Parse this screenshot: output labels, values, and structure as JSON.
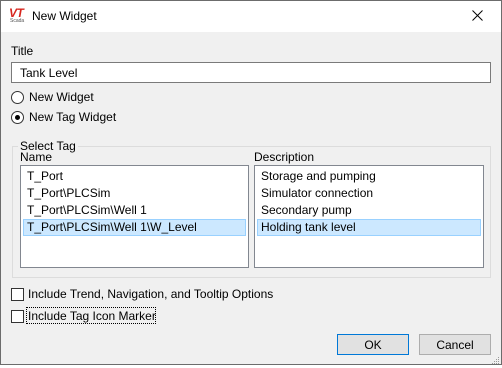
{
  "dialog": {
    "title": "New Widget",
    "logo_text": "VT",
    "logo_subtext": "Scada"
  },
  "title_field": {
    "label": "Title",
    "value": "Tank Level"
  },
  "widget_type": {
    "options": [
      {
        "label": "New Widget",
        "selected": false
      },
      {
        "label": "New Tag Widget",
        "selected": true
      }
    ]
  },
  "select_tag": {
    "group_label": "Select Tag",
    "name_header": "Name",
    "description_header": "Description",
    "names": [
      "T_Port",
      "T_Port\\PLCSim",
      "T_Port\\PLCSim\\Well 1",
      "T_Port\\PLCSim\\Well 1\\W_Level"
    ],
    "descriptions": [
      "Storage and pumping",
      "Simulator connection",
      "Secondary pump",
      "Holding tank level"
    ],
    "selected_index": 3
  },
  "options": {
    "include_trend": {
      "label": "Include Trend, Navigation, and Tooltip Options",
      "checked": false
    },
    "include_icon_marker": {
      "label": "Include Tag Icon Marker",
      "checked": false
    }
  },
  "buttons": {
    "ok": "OK",
    "cancel": "Cancel"
  },
  "colors": {
    "selection_bg": "#cce8ff",
    "selection_border": "#99d1ff",
    "dialog_bg": "#f0f0f0",
    "logo_red": "#d7261e"
  }
}
